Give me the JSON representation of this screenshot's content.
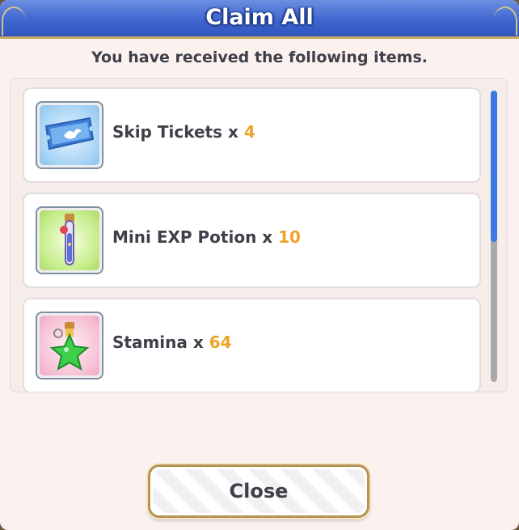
{
  "dialog": {
    "title": "Claim All",
    "subtitle": "You have received the following items.",
    "close_label": "Close"
  },
  "items": [
    {
      "name": "Skip Tickets",
      "separator": " x ",
      "quantity": "4",
      "icon": "ticket-icon"
    },
    {
      "name": "Mini EXP Potion",
      "separator": " x ",
      "quantity": "10",
      "icon": "potion-icon"
    },
    {
      "name": "Stamina",
      "separator": " x ",
      "quantity": "64",
      "icon": "stamina-bottle-icon"
    }
  ],
  "scroll": {
    "visible_fraction": 0.52
  },
  "colors": {
    "header": "#3f67cf",
    "quantity": "#f0a22a",
    "text": "#3f3f4a",
    "scroll_thumb": "#3b79e3"
  }
}
